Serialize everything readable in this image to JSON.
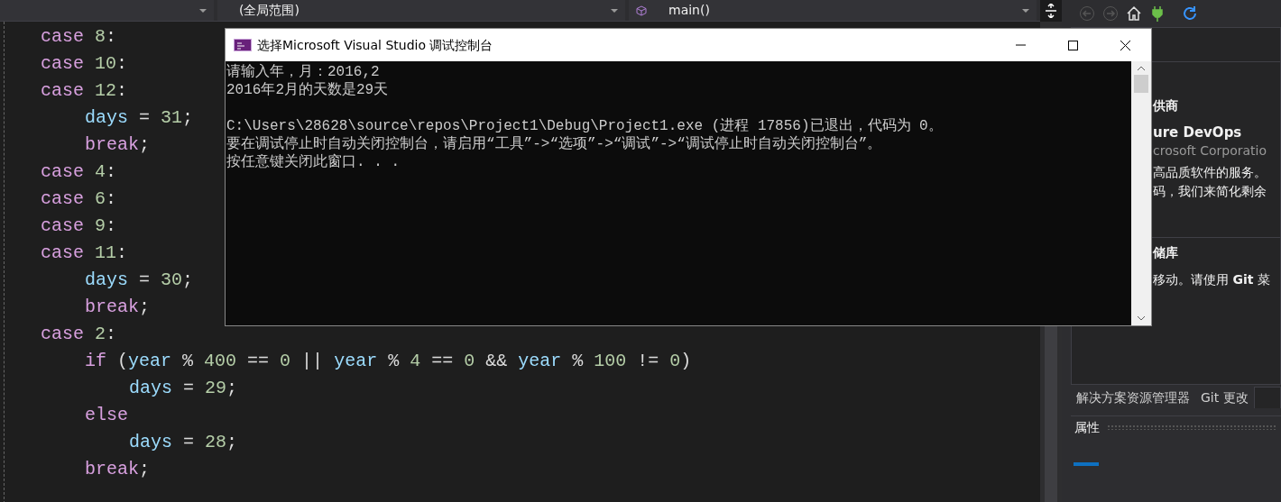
{
  "toolbar": {
    "dropdowns": [
      {
        "kind": "blank"
      },
      {
        "kind": "scope",
        "value": "(全局范围)"
      },
      {
        "kind": "member",
        "value": "main()"
      }
    ]
  },
  "nav_buttons": [
    {
      "kind": "back",
      "disabled": true
    },
    {
      "kind": "forward",
      "disabled": true
    },
    {
      "kind": "home",
      "disabled": false
    },
    {
      "kind": "connect",
      "disabled": false
    },
    {
      "kind": "refresh",
      "disabled": false
    }
  ],
  "editor": {
    "lines": [
      {
        "tokens": [
          {
            "kind": "kw",
            "text": "case "
          },
          {
            "kind": "num",
            "text": "8"
          },
          {
            "kind": "plain",
            "text": ":"
          }
        ]
      },
      {
        "tokens": [
          {
            "kind": "kw",
            "text": "case "
          },
          {
            "kind": "num",
            "text": "10"
          },
          {
            "kind": "plain",
            "text": ":"
          }
        ]
      },
      {
        "tokens": [
          {
            "kind": "kw",
            "text": "case "
          },
          {
            "kind": "num",
            "text": "12"
          },
          {
            "kind": "plain",
            "text": ":"
          }
        ],
        "children": [
          {
            "tokens": [
              {
                "kind": "id",
                "text": "days"
              },
              {
                "kind": "plain",
                "text": " = "
              },
              {
                "kind": "num",
                "text": "31"
              },
              {
                "kind": "plain",
                "text": ";"
              }
            ]
          },
          {
            "tokens": [
              {
                "kind": "kw",
                "text": "break"
              },
              {
                "kind": "plain",
                "text": ";"
              }
            ]
          }
        ]
      },
      {
        "tokens": [
          {
            "kind": "kw",
            "text": "case "
          },
          {
            "kind": "num",
            "text": "4"
          },
          {
            "kind": "plain",
            "text": ":"
          }
        ]
      },
      {
        "tokens": [
          {
            "kind": "kw",
            "text": "case "
          },
          {
            "kind": "num",
            "text": "6"
          },
          {
            "kind": "plain",
            "text": ":"
          }
        ]
      },
      {
        "tokens": [
          {
            "kind": "kw",
            "text": "case "
          },
          {
            "kind": "num",
            "text": "9"
          },
          {
            "kind": "plain",
            "text": ":"
          }
        ]
      },
      {
        "tokens": [
          {
            "kind": "kw",
            "text": "case "
          },
          {
            "kind": "num",
            "text": "11"
          },
          {
            "kind": "plain",
            "text": ":"
          }
        ],
        "children": [
          {
            "tokens": [
              {
                "kind": "id",
                "text": "days"
              },
              {
                "kind": "plain",
                "text": " = "
              },
              {
                "kind": "num",
                "text": "30"
              },
              {
                "kind": "plain",
                "text": ";"
              }
            ]
          },
          {
            "tokens": [
              {
                "kind": "kw",
                "text": "break"
              },
              {
                "kind": "plain",
                "text": ";"
              }
            ]
          }
        ]
      },
      {
        "tokens": [
          {
            "kind": "kw",
            "text": "case "
          },
          {
            "kind": "num",
            "text": "2"
          },
          {
            "kind": "plain",
            "text": ":"
          }
        ],
        "children": [
          {
            "tokens": [
              {
                "kind": "kw",
                "text": "if"
              },
              {
                "kind": "plain",
                "text": " ("
              },
              {
                "kind": "id",
                "text": "year"
              },
              {
                "kind": "plain",
                "text": " % "
              },
              {
                "kind": "num",
                "text": "400"
              },
              {
                "kind": "plain",
                "text": " == "
              },
              {
                "kind": "num",
                "text": "0"
              },
              {
                "kind": "plain",
                "text": " || "
              },
              {
                "kind": "id",
                "text": "year"
              },
              {
                "kind": "plain",
                "text": " % "
              },
              {
                "kind": "num",
                "text": "4"
              },
              {
                "kind": "plain",
                "text": " == "
              },
              {
                "kind": "num",
                "text": "0"
              },
              {
                "kind": "plain",
                "text": " && "
              },
              {
                "kind": "id",
                "text": "year"
              },
              {
                "kind": "plain",
                "text": " % "
              },
              {
                "kind": "num",
                "text": "100"
              },
              {
                "kind": "plain",
                "text": " != "
              },
              {
                "kind": "num",
                "text": "0"
              },
              {
                "kind": "plain",
                "text": ")"
              }
            ],
            "children": [
              {
                "tokens": [
                  {
                    "kind": "id",
                    "text": "days"
                  },
                  {
                    "kind": "plain",
                    "text": " = "
                  },
                  {
                    "kind": "num",
                    "text": "29"
                  },
                  {
                    "kind": "plain",
                    "text": ";"
                  }
                ]
              }
            ]
          },
          {
            "tokens": [
              {
                "kind": "kw",
                "text": "else"
              }
            ],
            "children": [
              {
                "tokens": [
                  {
                    "kind": "id",
                    "text": "days"
                  },
                  {
                    "kind": "plain",
                    "text": " = "
                  },
                  {
                    "kind": "num",
                    "text": "28"
                  },
                  {
                    "kind": "plain",
                    "text": ";"
                  }
                ]
              }
            ]
          },
          {
            "tokens": [
              {
                "kind": "kw",
                "text": "break"
              },
              {
                "kind": "plain",
                "text": ";"
              }
            ]
          }
        ]
      }
    ]
  },
  "console": {
    "title": "选择Microsoft Visual Studio 调试控制台",
    "paragraphs": [
      [
        "请输入年，月：2016,2",
        "2016年2月的天数是29天"
      ],
      [
        "C:\\Users\\28628\\source\\repos\\Project1\\Debug\\Project1.exe (进程 17856)已退出，代码为 0。",
        "要在调试停止时自动关闭控制台，请启用“工具”->“选项”->“调试”->“调试停止时自动关闭控制台”。",
        "按任意键关闭此窗口. . ."
      ]
    ]
  },
  "right_panel": {
    "sections": [
      {
        "heading": "供商",
        "items": [
          {
            "title": "ure DevOps",
            "subtitle": "crosoft Corporatio",
            "description": [
              "高品质软件的服务。",
              "码，我们来简化剩余"
            ]
          }
        ]
      },
      {
        "heading": "储库",
        "text": "移动。请使用 **Git** 菜"
      }
    ]
  },
  "bottom_tabs": [
    {
      "label": "解决方案资源管理器",
      "selected": false
    },
    {
      "label": "Git 更改",
      "selected": false
    },
    {
      "kind": "stub",
      "selected": true
    }
  ],
  "properties": {
    "title": "属性"
  }
}
